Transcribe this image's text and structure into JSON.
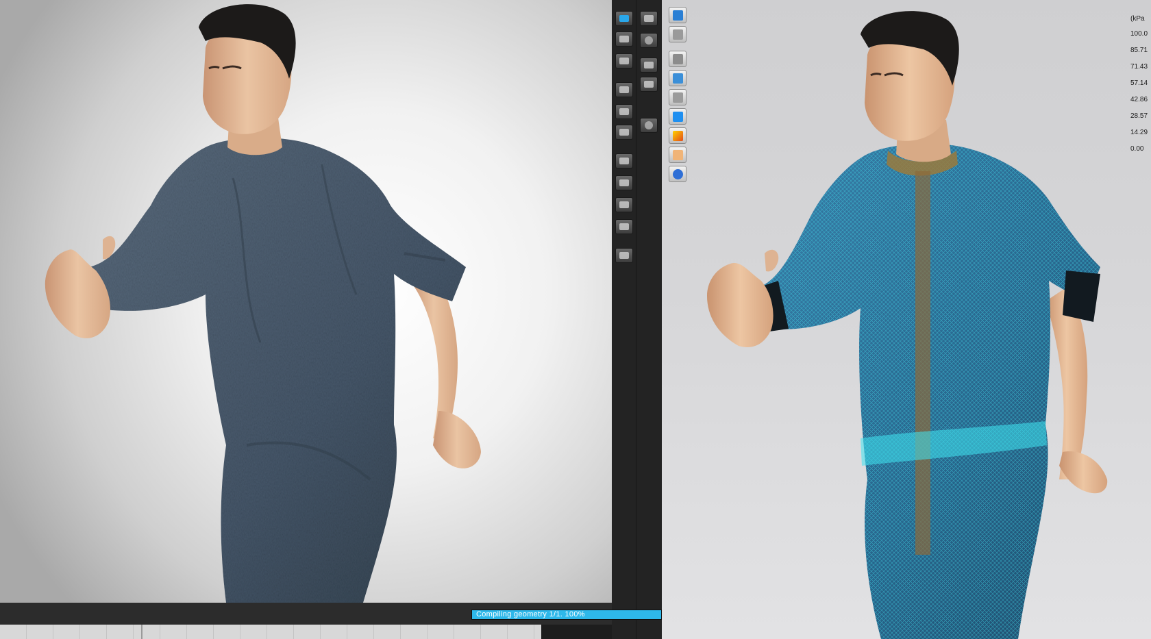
{
  "progress": {
    "label": "Compiling  geometry 1/1. 100%",
    "fraction": 1.0,
    "color": "#2eb8ea"
  },
  "legend": {
    "unit": "(kPa",
    "ticks": [
      "100.0",
      "85.71",
      "71.43",
      "57.14",
      "42.86",
      "28.57",
      "14.29",
      "0.00"
    ]
  },
  "toolbar": {
    "left_column_icons": [
      "simulate-icon",
      "record-icon",
      "clapper-icon",
      "render-window-icon",
      "snapshot-icon",
      "image-icon",
      "render-settings-icon",
      "camera-settings-icon",
      "light-settings-icon",
      "video-settings-icon",
      "camera-capture-icon"
    ],
    "right_column_icons": [
      "down-arrow-icon",
      "globe-icon",
      "wind-icon",
      "cone-icon",
      "dome-light-icon"
    ]
  },
  "sim_tools": {
    "icons": [
      "cube-icon",
      "shirt-icon",
      "show-garment-icon",
      "show-mesh-icon",
      "show-avatar-icon",
      "flat-shade-icon",
      "strain-map-icon",
      "skin-icon",
      "world-icon"
    ]
  },
  "colors": {
    "fabric": "#4a5a6c",
    "skin": "#e3b896",
    "hair": "#1c1a19",
    "sim_fabric": "#2d6f98",
    "mesh_glow": "#3fe3f0",
    "collar_strain": "#9a7a3c"
  }
}
